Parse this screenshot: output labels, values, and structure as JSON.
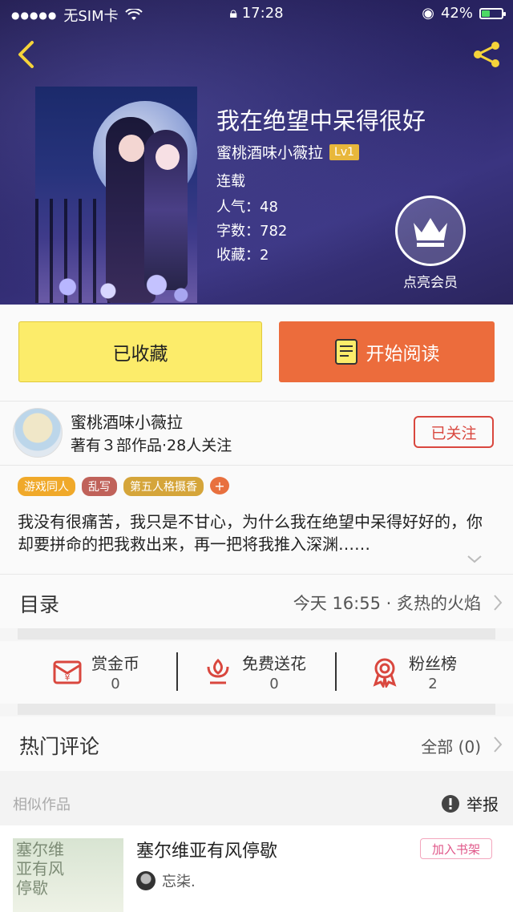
{
  "status_bar": {
    "carrier": "无SIM卡",
    "time": "17:28",
    "battery": "42%",
    "battery_level": 0.42
  },
  "book": {
    "title": "我在绝望中呆得很好",
    "author": "蜜桃酒味小薇拉",
    "level": "Lv1",
    "status": "连载",
    "popularity_label": "人气：",
    "popularity": "48",
    "words_label": "字数：",
    "words": "782",
    "favorites_label": "收藏：",
    "favorites": "2",
    "vip_label": "点亮会员"
  },
  "actions": {
    "favorited_label": "已收藏",
    "read_label": "开始阅读"
  },
  "author_card": {
    "name": "蜜桃酒味小薇拉",
    "stats": "著有３部作品·28人关注",
    "follow_label": "已关注"
  },
  "tags": [
    {
      "label": "游戏同人",
      "color": "#f0a92a"
    },
    {
      "label": "乱写",
      "color": "#c0625a"
    },
    {
      "label": "第五人格摄香",
      "color": "#d5a53a"
    },
    {
      "label": "+",
      "color": "#e8703e"
    }
  ],
  "description": "我没有很痛苦，我只是不甘心，为什么我在绝望中呆得好好的，你却要拼命的把我救出来，再一把将我推入深渊……",
  "toc": {
    "label": "目录",
    "latest": "今天 16:55 · 炙热的火焰"
  },
  "stats": [
    {
      "label": "赏金币",
      "value": "0",
      "icon": "red-envelope-icon"
    },
    {
      "label": "免费送花",
      "value": "0",
      "icon": "flower-icon"
    },
    {
      "label": "粉丝榜",
      "value": "2",
      "icon": "medal-icon"
    }
  ],
  "hot_comments": {
    "label": "热门评论",
    "all": "全部 (0)"
  },
  "similar": {
    "label": "相似作品",
    "report_label": "举报",
    "item": {
      "title": "塞尔维亚有风停歇",
      "cover_text": "塞尔维亚有风停歇",
      "author": "忘柒.",
      "add_label": "加入书架"
    }
  },
  "colors": {
    "accent_yellow": "#fcec6a",
    "accent_orange": "#ec6c3c",
    "follow_red": "#d9473e",
    "back_yellow": "#f5d33a"
  }
}
